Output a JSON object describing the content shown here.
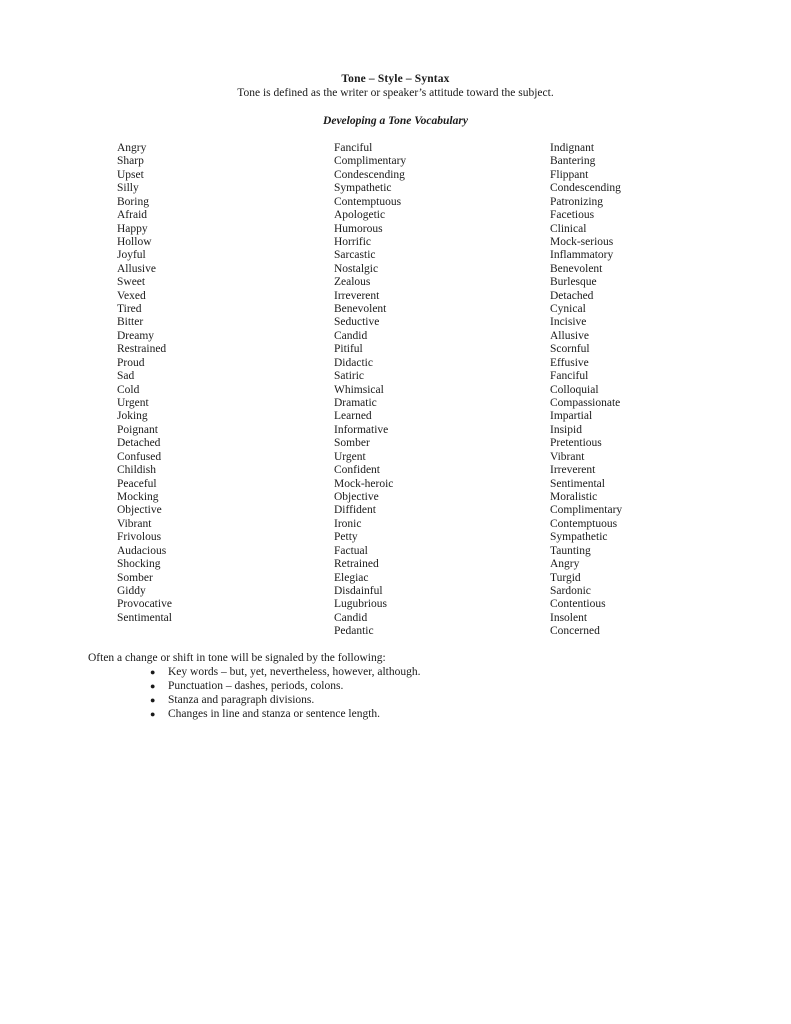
{
  "document": {
    "title": "Tone – Style – Syntax",
    "subtitle": "Tone is defined as the writer or speaker’s attitude toward the subject.",
    "section_heading": "Developing a Tone Vocabulary",
    "closing_line": "Often a change or shift in tone will be signaled by the following:",
    "bullet_marker": "●",
    "bullets": [
      "Key words – but, yet, nevertheless, however, although.",
      "Punctuation – dashes, periods, colons.",
      "Stanza and paragraph divisions.",
      "Changes in line and stanza or sentence length."
    ],
    "columns": [
      [
        "Angry",
        "Sharp",
        "Upset",
        "Silly",
        "Boring",
        "Afraid",
        "Happy",
        "Hollow",
        "Joyful",
        "Allusive",
        "Sweet",
        "Vexed",
        "Tired",
        "Bitter",
        "Dreamy",
        "Restrained",
        "Proud",
        "Sad",
        "Cold",
        "Urgent",
        "Joking",
        "Poignant",
        "Detached",
        "Confused",
        "Childish",
        "Peaceful",
        "Mocking",
        "Objective",
        "Vibrant",
        "Frivolous",
        "Audacious",
        "Shocking",
        "Somber",
        "Giddy",
        "Provocative",
        "Sentimental"
      ],
      [
        "Fanciful",
        "Complimentary",
        "Condescending",
        "Sympathetic",
        "Contemptuous",
        "Apologetic",
        "Humorous",
        "Horrific",
        "Sarcastic",
        "Nostalgic",
        "Zealous",
        "Irreverent",
        "Benevolent",
        "Seductive",
        "Candid",
        "Pitiful",
        "Didactic",
        "Satiric",
        "Whimsical",
        "Dramatic",
        "Learned",
        "Informative",
        "Somber",
        "Urgent",
        "Confident",
        "Mock-heroic",
        "Objective",
        "Diffident",
        "Ironic",
        "Petty",
        "Factual",
        "Retrained",
        "Elegiac",
        "Disdainful",
        "Lugubrious",
        "Candid",
        "Pedantic"
      ],
      [
        "Indignant",
        "Bantering",
        "Flippant",
        "Condescending",
        "Patronizing",
        "Facetious",
        "Clinical",
        "Mock-serious",
        "Inflammatory",
        "Benevolent",
        "Burlesque",
        "Detached",
        "Cynical",
        "Incisive",
        "Allusive",
        "Scornful",
        "Effusive",
        "Fanciful",
        "Colloquial",
        "Compassionate",
        "Impartial",
        "Insipid",
        "Pretentious",
        "Vibrant",
        "Irreverent",
        "Sentimental",
        "Moralistic",
        "Complimentary",
        "Contemptuous",
        "Sympathetic",
        "Taunting",
        "Angry",
        "Turgid",
        "Sardonic",
        "Contentious",
        "Insolent",
        "Concerned"
      ]
    ]
  }
}
